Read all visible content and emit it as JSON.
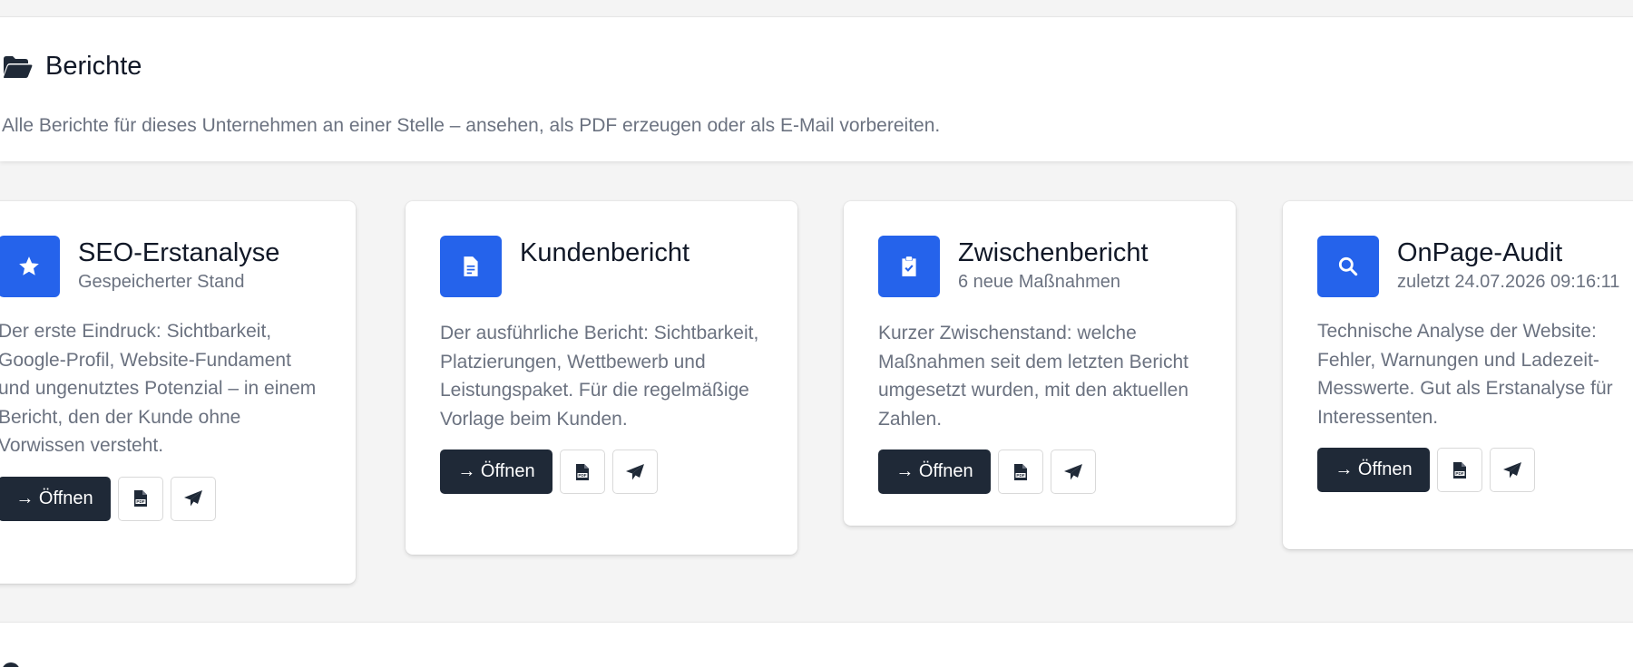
{
  "header": {
    "title": "Berichte",
    "icon": "folder-open-icon",
    "description": "Alle Berichte für dieses Unternehmen an einer Stelle – ansehen, als PDF erzeugen oder als E-Mail vorbereiten."
  },
  "cards": [
    {
      "icon": "star-icon",
      "title": "SEO-Erstanalyse",
      "subtitle": "Gespeicherter Stand",
      "description": "Der erste Eindruck: Sichtbarkeit, Google-Profil, Website-Fundament und ungenutztes Potenzial – in einem Bericht, den der Kunde ohne Vorwissen versteht.",
      "open_label": "→ Öffnen"
    },
    {
      "icon": "document-icon",
      "title": "Kundenbericht",
      "subtitle": "",
      "description": "Der ausführliche Bericht: Sichtbarkeit, Platzierungen, Wettbewerb und Leistungspaket. Für die regelmäßige Vorlage beim Kunden.",
      "open_label": "→ Öffnen"
    },
    {
      "icon": "clipboard-check-icon",
      "title": "Zwischenbericht",
      "subtitle": "6 neue Maßnahmen",
      "description": "Kurzer Zwischenstand: welche Maßnahmen seit dem letzten Bericht umgesetzt wurden, mit den aktuellen Zahlen.",
      "open_label": "→ Öffnen"
    },
    {
      "icon": "search-icon",
      "title": "OnPage-Audit",
      "subtitle": "zuletzt 24.07.2026 09:16:11",
      "description": "Technische Analyse der Website: Fehler, Warnungen und Ladezeit-Messwerte. Gut als Erstanalyse für Interessenten.",
      "open_label": "→ Öffnen"
    }
  ],
  "colors": {
    "accent": "#2563eb",
    "primary_button": "#1f2937",
    "muted_text": "#6b7280",
    "background": "#f4f4f4"
  }
}
